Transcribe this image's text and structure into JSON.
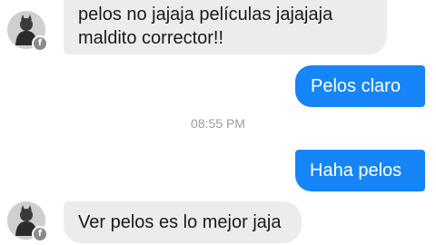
{
  "messages": [
    {
      "from": "contact",
      "text_line1": "pelos no jajaja películas jajajaja",
      "text_line2": "maldito corrector!!"
    },
    {
      "from": "me",
      "text": "Pelos claro"
    },
    {
      "from": "me",
      "text": "Haha pelos"
    },
    {
      "from": "contact",
      "text": "Ver pelos es lo mejor jaja"
    }
  ],
  "timestamp": "08:55 PM",
  "avatar_badge": "f",
  "colors": {
    "outgoing_bubble": "#1585f7",
    "incoming_bubble": "#ececec",
    "timestamp": "#9b9b9b"
  },
  "icons": {
    "avatar": "contact-avatar-icon",
    "badge": "facebook-badge-icon"
  }
}
